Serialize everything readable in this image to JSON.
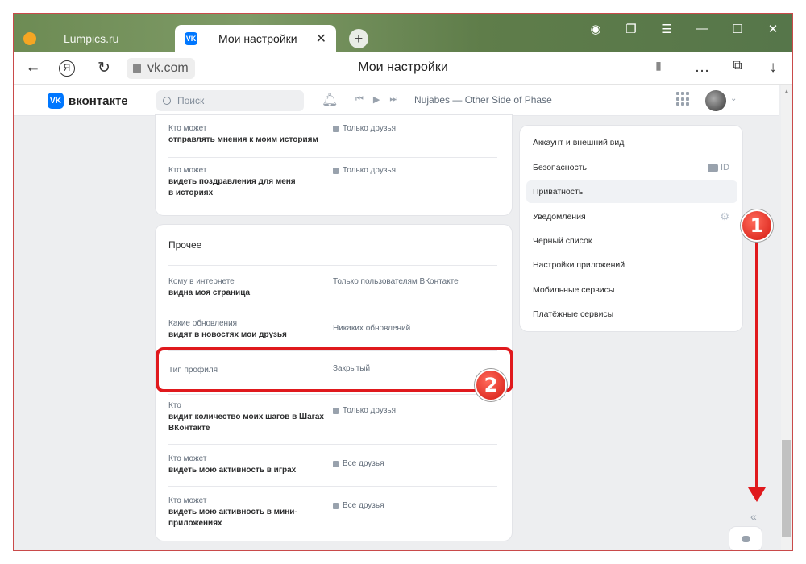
{
  "browser": {
    "tabs": [
      {
        "label": "Lumpics.ru"
      },
      {
        "label": "Мои настройки",
        "close": "✕"
      }
    ],
    "new_tab": "+",
    "window_controls": [
      "☰",
      "—",
      "☐",
      "✕"
    ],
    "url": "vk.com",
    "page_title": "Мои настройки",
    "nav": {
      "back": "←",
      "yandex": "Я",
      "reload": "↻"
    },
    "toolbar": {
      "bookmark": "▮",
      "more": "…",
      "download": "↓"
    }
  },
  "vk": {
    "logo_text": "вконтакте",
    "search_placeholder": "Поиск",
    "track": "Nujabes — Other Side of Phase"
  },
  "privacy_top": [
    {
      "line1": "Кто может",
      "line2": "отправлять мнения к моим историям",
      "value": "Только друзья"
    },
    {
      "line1": "Кто может",
      "line2": "видеть поздравления для меня",
      "line3": "в историях",
      "value": "Только друзья"
    }
  ],
  "other_section": {
    "title": "Прочее",
    "rows": [
      {
        "line1": "Кому в интернете",
        "line2": "видна моя страница",
        "value": "Только пользователям ВКонтакте"
      },
      {
        "line1": "Какие обновления",
        "line2": "видят в новостях мои друзья",
        "value": "Никаких обновлений"
      },
      {
        "line1": "Тип профиля",
        "line2": "",
        "value": "Закрытый"
      },
      {
        "line1": "Кто",
        "line2": "видит количество моих шагов в Шагах",
        "line3": "ВКонтакте",
        "value": "Только друзья"
      },
      {
        "line1": "Кто может",
        "line2": "видеть мою активность в играх",
        "value": "Все друзья"
      },
      {
        "line1": "Кто может",
        "line2": "видеть мою активность в мини-",
        "line3": "приложениях",
        "value": "Все друзья"
      }
    ]
  },
  "settings_menu": [
    {
      "label": "Аккаунт и внешний вид"
    },
    {
      "label": "Безопасность",
      "badge": "ID"
    },
    {
      "label": "Приватность",
      "active": true
    },
    {
      "label": "Уведомления"
    },
    {
      "label": "Чёрный список"
    },
    {
      "label": "Настройки приложений"
    },
    {
      "label": "Мобильные сервисы"
    },
    {
      "label": "Платёжные сервисы"
    }
  ],
  "annotations": {
    "marker1": "1",
    "marker2": "2"
  },
  "colors": {
    "accent": "#0077ff",
    "annotation": "#e0191d"
  }
}
